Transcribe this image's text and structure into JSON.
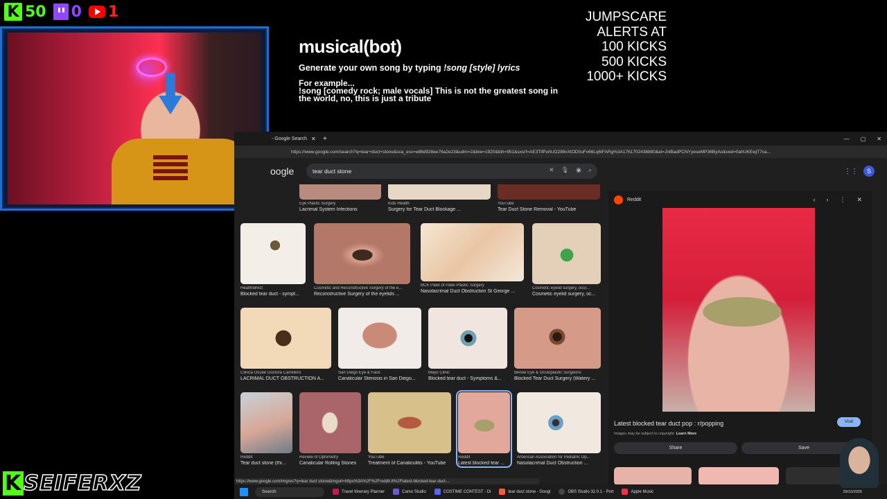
{
  "counters": {
    "kick": "50",
    "twitch": "0",
    "youtube": "1"
  },
  "bot": {
    "logo": "musical(bot)",
    "instruction_prefix": "Generate your own song by typing ",
    "instruction_cmd": "!song [style] lyrics",
    "example_label": "For example...",
    "example_text": "!song [comedy rock; male vocals] This is not the greatest song in the world, no, this is just a tribute"
  },
  "jumpscare": {
    "line1": "JUMPSCARE",
    "line2": "ALERTS AT",
    "line3": "100 KICKS",
    "line4": "500 KICKS",
    "line5": "1000+ KICKS"
  },
  "browser": {
    "tab_title": "- Google Search",
    "url": "https://www.google.com/search?q=tear+duct+stone&sca_esv=e88d928ee76a2e23&udm=2&biw=1920&bih=951&sxsrf=AE3TifPuhUO289vXtOD0uFv66Lq6IFARg%3A1761702438880&ei=JnlBadPCNYyeseMP36ByAo&ved=0ahUKEwjT7ca...",
    "logo": "oogle",
    "search_value": "tear duct stone",
    "avatar_letter": "S",
    "status_url": "https://www.google.com/imgres?q=tear duct stone&imgurl=https%3A%2F%2Freddit.it%2Flatest-blocked-tear-duct-..."
  },
  "results": [
    {
      "src": "Healthdirect",
      "title": "Blocked tear duct - sympt..."
    },
    {
      "src": "Cosmetic and Reconstructive Surgery of the e...",
      "title": "Reconstructive Surgery of the eyelids ..."
    },
    {
      "src": "BCK Patel of Patel Plastic Surgery",
      "title": "Nasolacrimal Duct Obstruction St George ..."
    },
    {
      "src": "Cosmetic eyelid surgery, ocul...",
      "title": "Cosmetic eyelid surgery, oc..."
    },
    {
      "src": "Clinica Ocular Doctora Carretero",
      "title": "LACRIMAL DUCT OBSTRUCTION A..."
    },
    {
      "src": "San Diego Eye & Face",
      "title": "Canalicular Stenosis in San Diego..."
    },
    {
      "src": "Mayo Clinic",
      "title": "Blocked tear duct - Symptoms &..."
    },
    {
      "src": "Benoe Eye & Oculoplastic Surgeons",
      "title": "Blocked Tear Duct Surgery (Watery ..."
    },
    {
      "src": "Reddit",
      "title": "Tear duct stone (thr..."
    },
    {
      "src": "Review of Optometry",
      "title": "Canalicular Rolling Stones"
    },
    {
      "src": "YouTube",
      "title": "Treatment of Canaliculitis - YouTube"
    },
    {
      "src": "Reddit",
      "title": "Latest blocked tear ..."
    },
    {
      "src": "American Association for Pediatric Op...",
      "title": "Nasolacrimal Duct Obstruction ..."
    }
  ],
  "top_row": [
    {
      "src": "Eye Plastic Surgery",
      "title": "Lacrimal System Infections"
    },
    {
      "src": "Kids Health",
      "title": "Surgery for Tear Duct Blockage ..."
    },
    {
      "src": "YouTube",
      "title": "Tear Duct Stone Removal - YouTube"
    }
  ],
  "preview": {
    "source": "Reddit",
    "title": "Latest blocked tear duct pop : r/popping",
    "visit": "Visit",
    "copyright": "Images may be subject to copyright.",
    "learn_more": "Learn More",
    "share": "Share",
    "save": "Save"
  },
  "taskbar": {
    "search": "Search",
    "apps": [
      "Travel Itinerary Planner",
      "Camo Studio",
      "COSTIME CONTEST - Di",
      "tear duct stone - Googl",
      "OBS Studio 32.0.1 - Port",
      "Apple Music"
    ],
    "time": "29/10/2025"
  },
  "brand": {
    "k": "K",
    "name": "SEIFERXZ"
  },
  "colors": {
    "kick_green": "#53fc18",
    "twitch_purple": "#9146ff",
    "youtube_red": "#ff0000",
    "link_blue": "#8ab4f8"
  }
}
